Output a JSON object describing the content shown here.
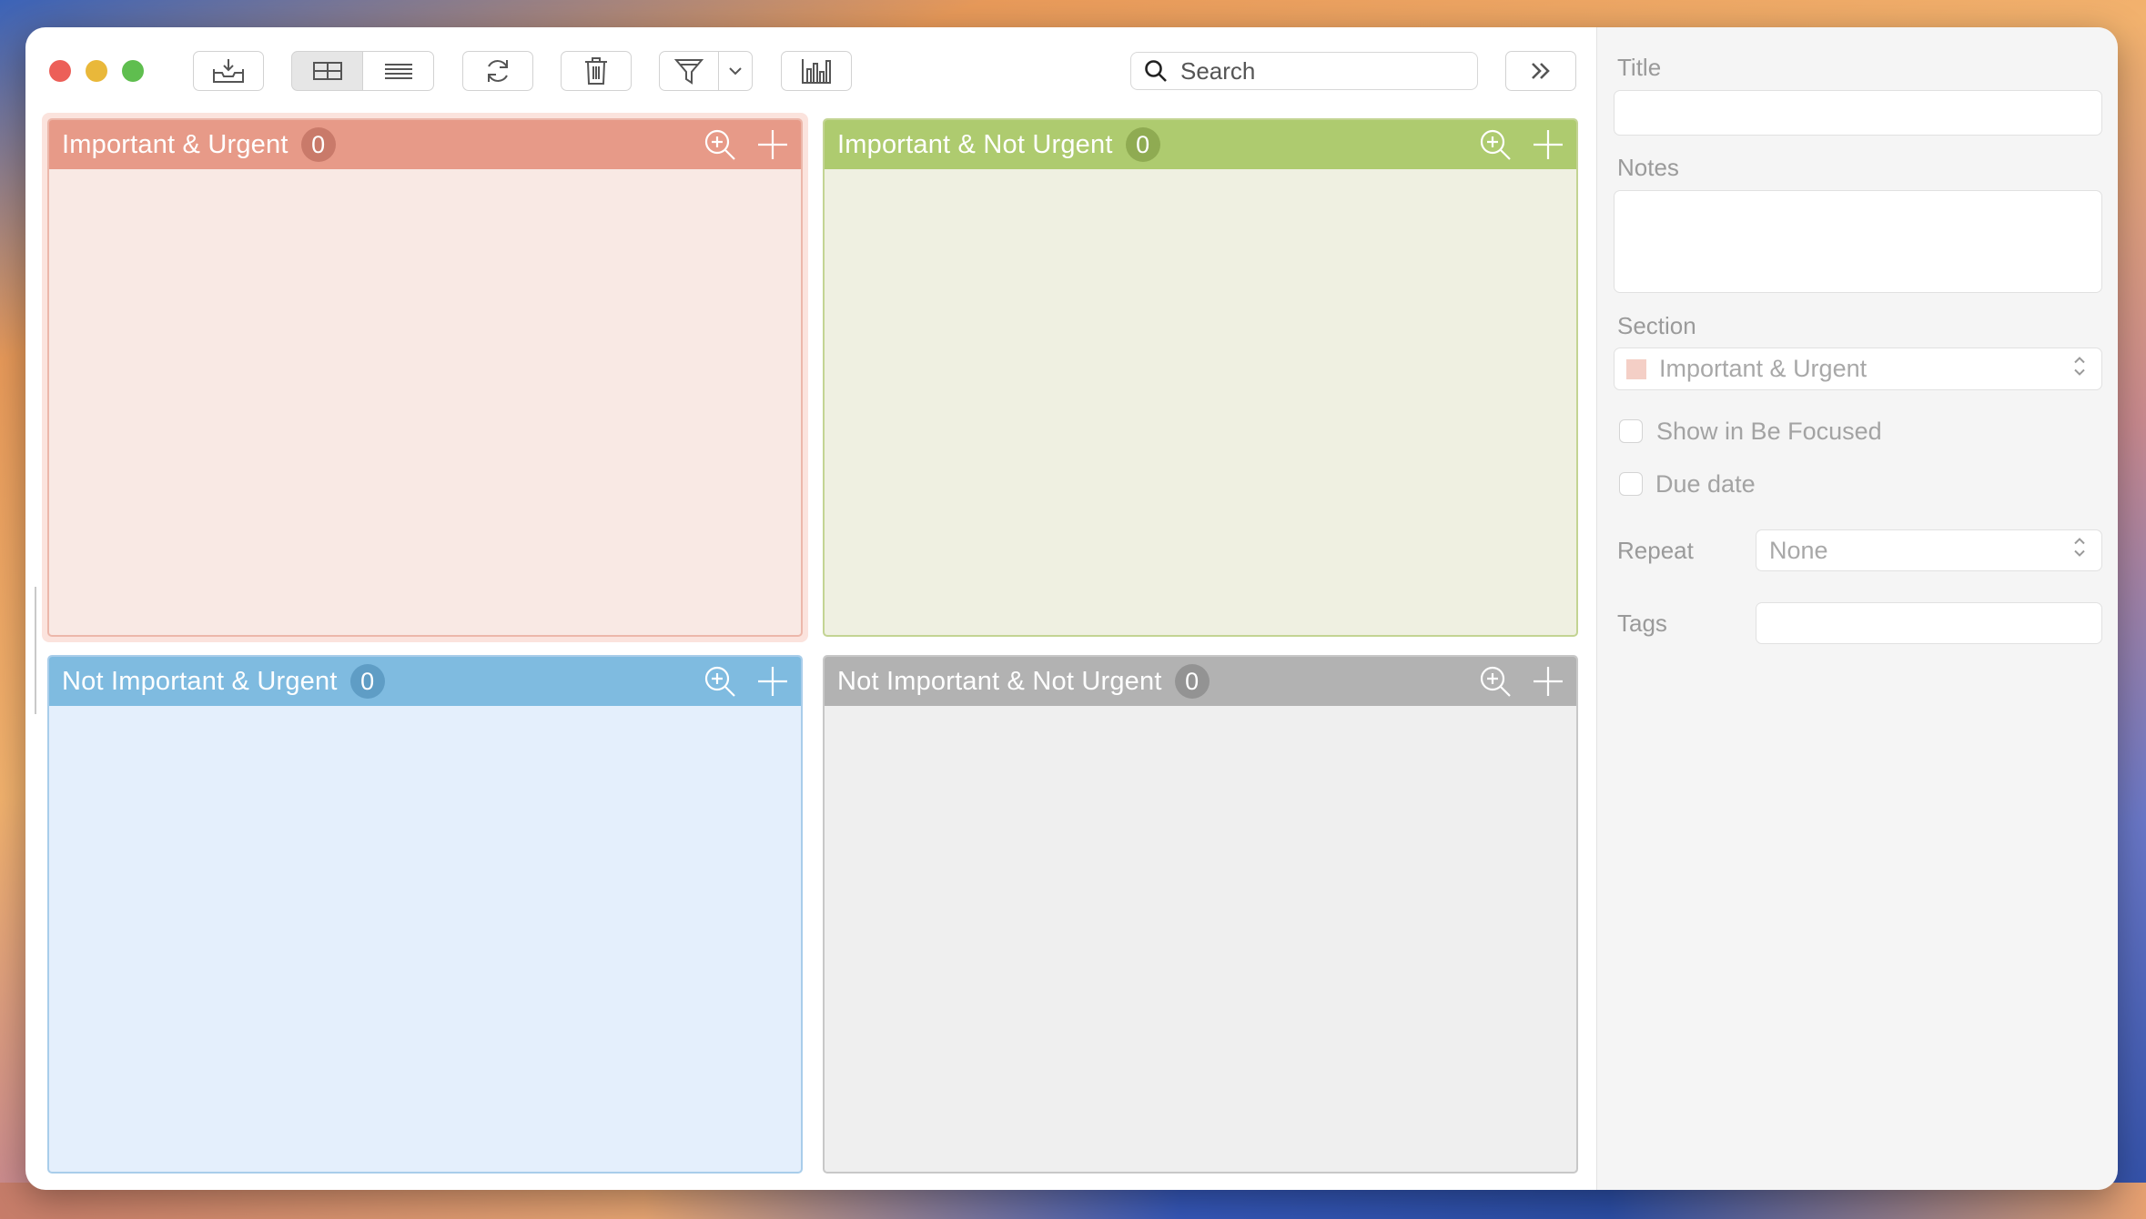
{
  "toolbar": {
    "search_placeholder": "Search"
  },
  "quadrants": [
    {
      "title": "Important & Urgent",
      "count": "0",
      "color": "#e79a88"
    },
    {
      "title": "Important & Not Urgent",
      "count": "0",
      "color": "#aecb6f"
    },
    {
      "title": "Not Important & Urgent",
      "count": "0",
      "color": "#7fbbe0"
    },
    {
      "title": "Not Important & Not Urgent",
      "count": "0",
      "color": "#b2b2b2"
    }
  ],
  "inspector": {
    "title_label": "Title",
    "title_value": "",
    "notes_label": "Notes",
    "notes_value": "",
    "section_label": "Section",
    "section_value": "Important & Urgent",
    "section_swatch_color": "#f4cfc6",
    "show_focused_label": "Show in Be Focused",
    "show_focused_checked": false,
    "due_date_label": "Due date",
    "due_date_checked": false,
    "repeat_label": "Repeat",
    "repeat_value": "None",
    "tags_label": "Tags",
    "tags_value": ""
  }
}
